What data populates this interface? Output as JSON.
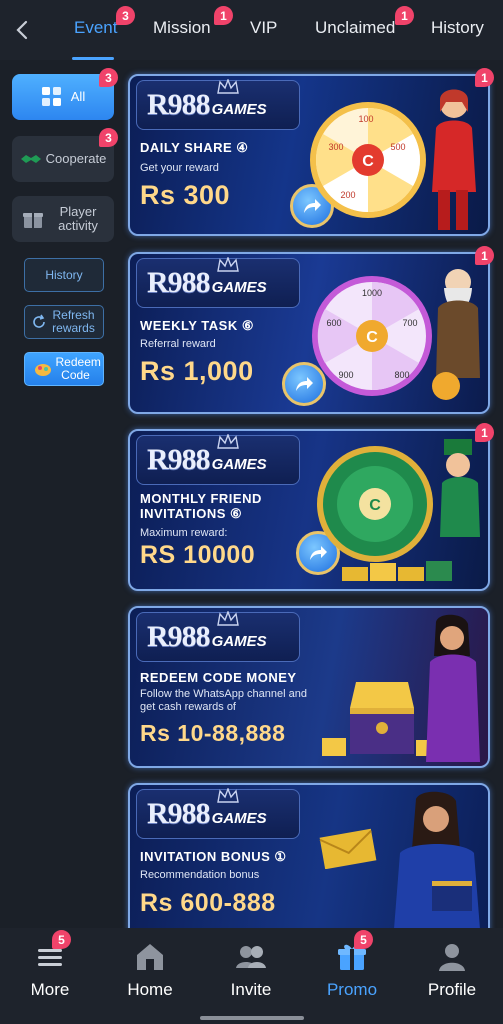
{
  "topbar": {
    "tabs": [
      {
        "label": "Event",
        "badge": "3",
        "active": true
      },
      {
        "label": "Mission",
        "badge": "1"
      },
      {
        "label": "VIP",
        "badge": ""
      },
      {
        "label": "Unclaimed",
        "badge": "1"
      },
      {
        "label": "History",
        "badge": ""
      }
    ]
  },
  "sidebar": {
    "items": [
      {
        "label": "All",
        "badge": "3",
        "active": true
      },
      {
        "label": "Cooperate",
        "badge": "3"
      },
      {
        "label": "Player activity",
        "badge": ""
      }
    ],
    "history_label": "History",
    "refresh_label": "Refresh rewards",
    "redeem_label": "Redeem Code"
  },
  "banners": [
    {
      "brand": "R988",
      "brand_suffix": "GAMES",
      "title": "DAILY SHARE ④",
      "subtitle": "Get your reward",
      "amount": "Rs 300",
      "badge": "1"
    },
    {
      "brand": "R988",
      "brand_suffix": "GAMES",
      "title": "WEEKLY TASK ⑥",
      "subtitle": "Referral reward",
      "amount": "Rs 1,000",
      "badge": "1"
    },
    {
      "brand": "R988",
      "brand_suffix": "GAMES",
      "title": "MONTHLY FRIEND INVITATIONS ⑥",
      "subtitle": "Maximum reward:",
      "amount": "RS 10000",
      "badge": "1"
    },
    {
      "brand": "R988",
      "brand_suffix": "GAMES",
      "title": "REDEEM CODE MONEY",
      "subtitle": "Follow the WhatsApp channel and get cash rewards of",
      "amount": "Rs 10-88,888",
      "badge": ""
    },
    {
      "brand": "R988",
      "brand_suffix": "GAMES",
      "title": "INVITATION BONUS ①",
      "subtitle": "Recommendation bonus",
      "amount": "Rs 600-888",
      "badge": ""
    }
  ],
  "wheel_numbers": {
    "daily": [
      "100",
      "300",
      "500",
      "?",
      "200",
      "?"
    ],
    "weekly": [
      "1000",
      "600",
      "700",
      "900",
      "800"
    ]
  },
  "bottom_nav": {
    "items": [
      {
        "label": "More",
        "badge": "5",
        "icon": "menu-icon"
      },
      {
        "label": "Home",
        "badge": "",
        "icon": "home-icon"
      },
      {
        "label": "Invite",
        "badge": "",
        "icon": "people-icon"
      },
      {
        "label": "Promo",
        "badge": "5",
        "icon": "gift-icon",
        "active": true
      },
      {
        "label": "Profile",
        "badge": "",
        "icon": "user-icon"
      }
    ]
  },
  "colors": {
    "background": "#1b2028",
    "accent": "#4aa3ff",
    "badge": "#f0436a",
    "amount": "#ffd88a"
  }
}
